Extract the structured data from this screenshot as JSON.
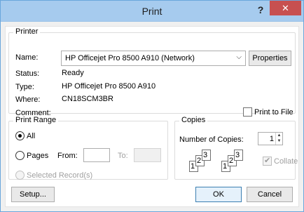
{
  "window": {
    "title": "Print",
    "help_glyph": "?",
    "close_glyph": "✕"
  },
  "printer": {
    "group_label": "Printer",
    "name_label": "Name:",
    "name_value": "HP Officejet Pro 8500 A910 (Network)",
    "properties_button": "Properties",
    "status_label": "Status:",
    "status_value": "Ready",
    "type_label": "Type:",
    "type_value": "HP Officejet Pro 8500 A910",
    "where_label": "Where:",
    "where_value": "CN18SCM3BR",
    "comment_label": "Comment:",
    "print_to_file_label": "Print to File",
    "print_to_file_checked": false
  },
  "print_range": {
    "group_label": "Print Range",
    "all_label": "All",
    "pages_label": "Pages",
    "from_label": "From:",
    "from_value": "",
    "to_label": "To:",
    "to_value": "",
    "selected_records_label": "Selected Record(s)",
    "selected": "all"
  },
  "copies": {
    "group_label": "Copies",
    "number_label": "Number of Copies:",
    "number_value": "1",
    "collate_label": "Collate",
    "collate_checked": true,
    "page_numbers": [
      "1",
      "2",
      "3"
    ]
  },
  "footer": {
    "setup_button": "Setup...",
    "ok_button": "OK",
    "cancel_button": "Cancel"
  },
  "icons": {
    "dropdown": "chevron-down-icon",
    "spin_up": "spin-up-icon",
    "spin_down": "spin-down-icon"
  }
}
